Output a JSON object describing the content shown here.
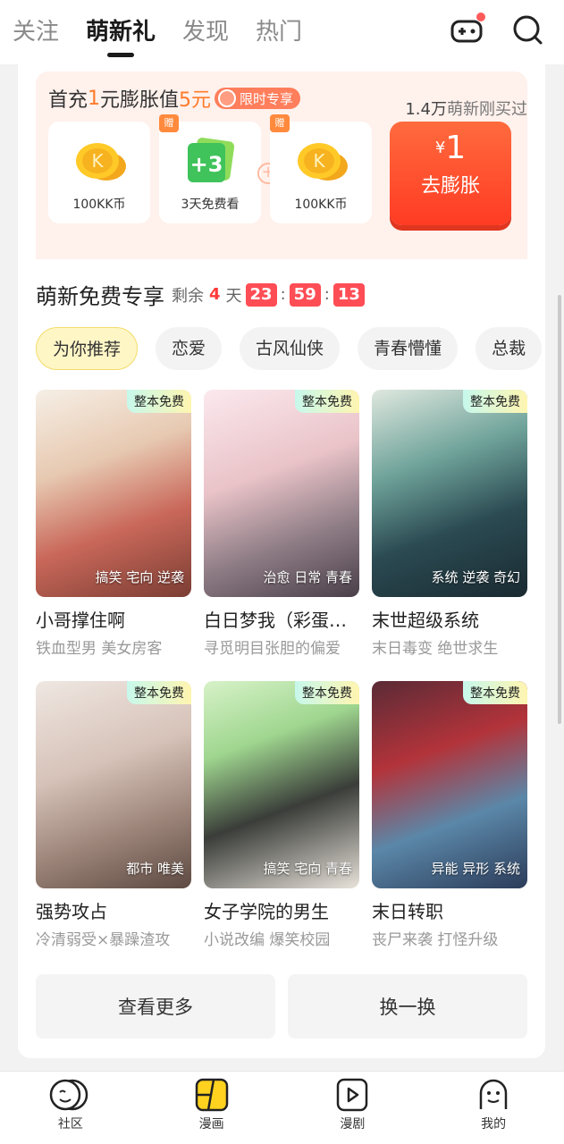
{
  "topnav": {
    "tabs": [
      {
        "label": "关注",
        "active": false
      },
      {
        "label": "萌新礼",
        "active": true
      },
      {
        "label": "发现",
        "active": false
      },
      {
        "label": "热门",
        "active": false
      }
    ],
    "icons": [
      "game-controller-icon",
      "search-icon"
    ]
  },
  "promo": {
    "head_prefix": "首充",
    "head_num1": "1",
    "head_mid": "元膨胀值",
    "head_num2": "5元",
    "limit_label": "限时专享",
    "bought_count": "1.4万",
    "bought_text": "萌新刚买过",
    "rewards": [
      {
        "label": "100KK币",
        "gift": false
      },
      {
        "label": "3天免费看",
        "gift": true
      },
      {
        "label": "100KK币",
        "gift": true
      }
    ],
    "gift_tag": "赠",
    "coin_letter": "K",
    "three_days_badge": "+3",
    "plus_symbol": "+",
    "buy_currency": "¥",
    "buy_price": "1",
    "buy_label": "去膨胀"
  },
  "free": {
    "title": "萌新免费专享",
    "rest_label": "剩余",
    "days": "4",
    "days_unit": "天",
    "hours": "23",
    "minutes": "59",
    "seconds": "13",
    "colon": ":",
    "chips": [
      "为你推荐",
      "恋爱",
      "古风仙侠",
      "青春懵懂",
      "总裁"
    ],
    "free_tag": "整本免费",
    "books": [
      {
        "name": "小哥撑住啊",
        "desc": "铁血型男 美女房客",
        "tags": "搞笑 宅向 逆袭"
      },
      {
        "name": "白日梦我（彩蛋版）",
        "desc": "寻觅明目张胆的偏爱",
        "tags": "治愈 日常 青春"
      },
      {
        "name": "末世超级系统",
        "desc": "末日毒变 绝世求生",
        "tags": "系统 逆袭 奇幻"
      },
      {
        "name": "强势攻占",
        "desc": "冷清弱受×暴躁渣攻",
        "tags": "都市 唯美"
      },
      {
        "name": "女子学院的男生",
        "desc": "小说改编 爆笑校园",
        "tags": "搞笑 宅向 青春"
      },
      {
        "name": "末日转职",
        "desc": "丧尸来袭 打怪升级",
        "tags": "异能 异形 系统"
      }
    ],
    "more_btn": "查看更多",
    "refresh_btn": "换一换"
  },
  "bottomnav": [
    {
      "label": "社区",
      "icon": "community-icon"
    },
    {
      "label": "漫画",
      "icon": "comic-icon"
    },
    {
      "label": "漫剧",
      "icon": "play-icon"
    },
    {
      "label": "我的",
      "icon": "profile-icon"
    }
  ]
}
